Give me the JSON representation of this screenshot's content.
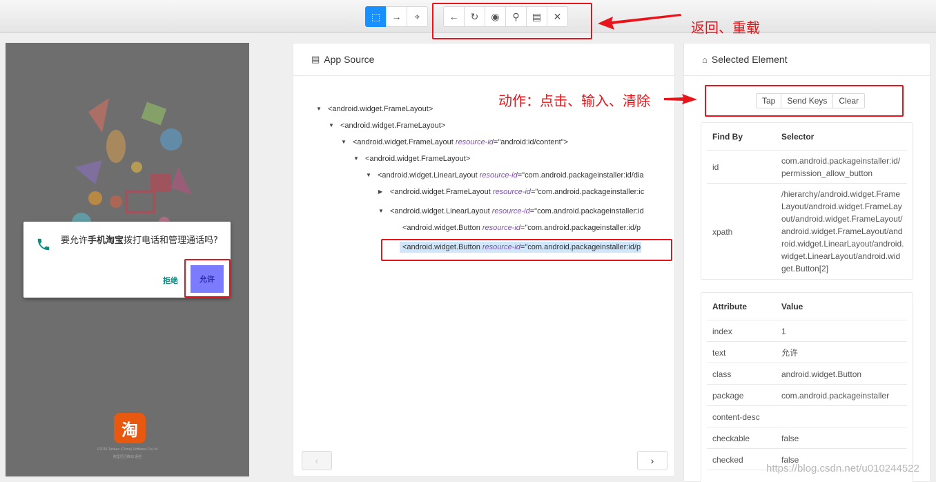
{
  "toolbar": {
    "mode_buttons": [
      {
        "name": "select-mode",
        "icon": "select-element-icon",
        "glyph": "⬚"
      },
      {
        "name": "swipe-mode",
        "icon": "arrow-right-icon",
        "glyph": "→"
      },
      {
        "name": "tap-coordinates-mode",
        "icon": "crosshair-icon",
        "glyph": "⌖"
      }
    ],
    "action_buttons": [
      {
        "name": "back",
        "icon": "back-arrow-icon",
        "glyph": "←"
      },
      {
        "name": "refresh",
        "icon": "refresh-icon",
        "glyph": "↻"
      },
      {
        "name": "toggle-visibility",
        "icon": "eye-icon",
        "glyph": "◉"
      },
      {
        "name": "search",
        "icon": "search-icon",
        "glyph": "⚲"
      },
      {
        "name": "copy-xml",
        "icon": "file-icon",
        "glyph": "▤"
      },
      {
        "name": "quit",
        "icon": "close-icon",
        "glyph": "✕"
      }
    ]
  },
  "annotations": {
    "toolbar_note": "返回、重载",
    "actions_note": "动作：点击、输入、清除"
  },
  "device": {
    "dialog_text_plain_1": "要允许",
    "dialog_text_bold": "手机淘宝",
    "dialog_text_plain_2": "拨打电话和管理通话吗?",
    "deny_label": "拒绝",
    "allow_label": "允许",
    "app_icon_char": "淘",
    "copyright_line1": "©2018 Taobao (China) Software Co.Ltd",
    "copyright_line2": "阿里巴巴移动 通信"
  },
  "source_panel": {
    "title": "App Source",
    "nodes": [
      {
        "tag": "<android.widget.FrameLayout>",
        "attr_name": "",
        "attr_value": "",
        "caret": "▼"
      },
      {
        "tag": "<android.widget.FrameLayout>",
        "attr_name": "",
        "attr_value": "",
        "caret": "▼"
      },
      {
        "tag": "<android.widget.FrameLayout ",
        "attr_name": "resource-id",
        "attr_value": "=\"android:id/content\">",
        "caret": "▼"
      },
      {
        "tag": "<android.widget.FrameLayout>",
        "attr_name": "",
        "attr_value": "",
        "caret": "▼"
      },
      {
        "tag": "<android.widget.LinearLayout ",
        "attr_name": "resource-id",
        "attr_value": "=\"com.android.packageinstaller:id/dia",
        "caret": "▼"
      },
      {
        "tag": "<android.widget.FrameLayout ",
        "attr_name": "resource-id",
        "attr_value": "=\"com.android.packageinstaller:ic",
        "caret": "▶"
      },
      {
        "tag": "<android.widget.LinearLayout ",
        "attr_name": "resource-id",
        "attr_value": "=\"com.android.packageinstaller:id",
        "caret": "▼"
      },
      {
        "tag": "<android.widget.Button ",
        "attr_name": "resource-id",
        "attr_value": "=\"com.android.packageinstaller:id/p",
        "caret": ""
      },
      {
        "tag": "<android.widget.Button ",
        "attr_name": "resource-id",
        "attr_value": "=\"com.android.packageinstaller:id/p",
        "caret": ""
      }
    ],
    "prev_label": "‹",
    "next_label": "›"
  },
  "selected_panel": {
    "title": "Selected Element",
    "actions": [
      "Tap",
      "Send Keys",
      "Clear"
    ],
    "find_by_header": {
      "col1": "Find By",
      "col2": "Selector"
    },
    "find_by_rows": [
      {
        "key": "id",
        "value": "com.android.packageinstaller:id/permission_allow_button"
      },
      {
        "key": "xpath",
        "value": "/hierarchy/android.widget.FrameLayout/android.widget.FrameLayout/android.widget.FrameLayout/android.widget.FrameLayout/android.widget.LinearLayout/android.widget.LinearLayout/android.widget.Button[2]"
      }
    ],
    "attr_header": {
      "col1": "Attribute",
      "col2": "Value"
    },
    "attr_rows": [
      {
        "key": "index",
        "value": "1"
      },
      {
        "key": "text",
        "value": "允许"
      },
      {
        "key": "class",
        "value": "android.widget.Button"
      },
      {
        "key": "package",
        "value": "com.android.packageinstaller"
      },
      {
        "key": "content-desc",
        "value": ""
      },
      {
        "key": "checkable",
        "value": "false"
      },
      {
        "key": "checked",
        "value": "false"
      }
    ]
  },
  "watermark": "https://blog.csdn.net/u010244522"
}
